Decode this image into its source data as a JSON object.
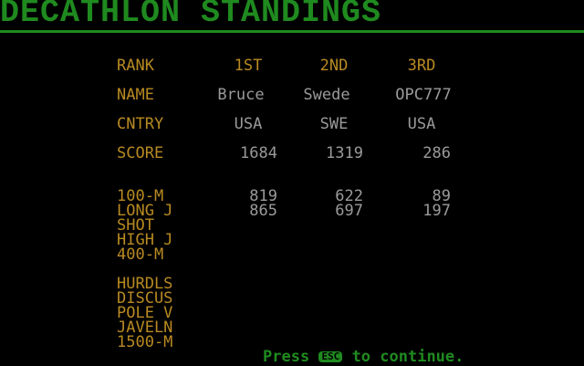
{
  "title": "DECATHLON STANDINGS",
  "headers": {
    "rank": "RANK",
    "first": "1ST",
    "second": "2ND",
    "third": "3RD"
  },
  "name_label": "NAME",
  "names": [
    "Bruce",
    "Swede",
    "OPC777"
  ],
  "country_label": "CNTRY",
  "countries": [
    "USA",
    "SWE",
    "USA"
  ],
  "score_label": "SCORE",
  "scores": [
    "1684",
    "1319",
    "286"
  ],
  "events": [
    {
      "label": "100-M",
      "scores": [
        "819",
        "622",
        "89"
      ]
    },
    {
      "label": "LONG J",
      "scores": [
        "865",
        "697",
        "197"
      ]
    },
    {
      "label": "SHOT",
      "scores": [
        "",
        "",
        ""
      ]
    },
    {
      "label": "HIGH J",
      "scores": [
        "",
        "",
        ""
      ]
    },
    {
      "label": "400-M",
      "scores": [
        "",
        "",
        ""
      ]
    },
    {
      "label": "HURDLS",
      "scores": [
        "",
        "",
        ""
      ]
    },
    {
      "label": "DISCUS",
      "scores": [
        "",
        "",
        ""
      ]
    },
    {
      "label": "POLE V",
      "scores": [
        "",
        "",
        ""
      ]
    },
    {
      "label": "JAVELN",
      "scores": [
        "",
        "",
        ""
      ]
    },
    {
      "label": "1500-M",
      "scores": [
        "",
        "",
        ""
      ]
    }
  ],
  "footer": {
    "press": "Press",
    "key": "ESC",
    "rest": "to continue."
  },
  "colors": {
    "green": "#1f8a1f",
    "yellow": "#b88a22",
    "gray": "#9a9a9a",
    "background": "#000000"
  }
}
